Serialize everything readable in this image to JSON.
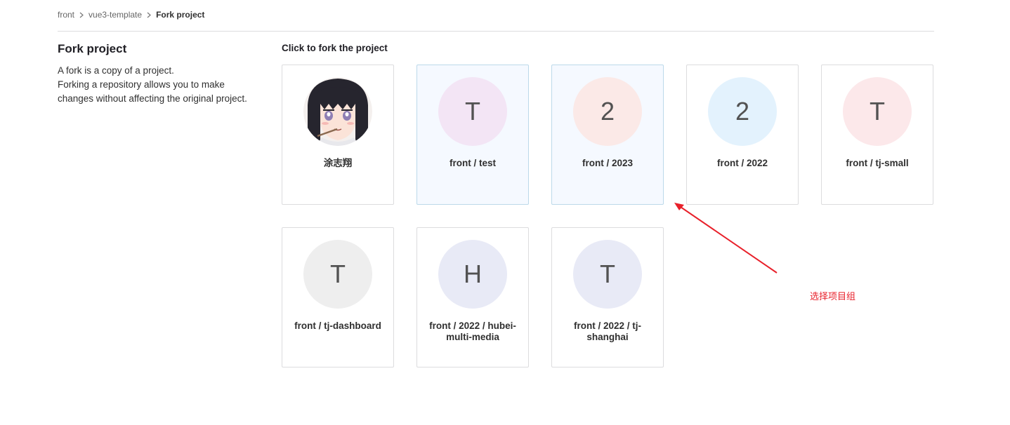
{
  "breadcrumb": {
    "items": [
      "front",
      "vue3-template",
      "Fork project"
    ]
  },
  "page": {
    "title": "Fork project",
    "description_lines": [
      "A fork is a copy of a project.",
      "Forking a repository allows you to make changes without affecting the original project."
    ],
    "section_title": "Click to fork the project"
  },
  "namespaces": [
    {
      "name": "涂志翔",
      "avatar_type": "image",
      "avatar_name": "anime-girl-avatar",
      "selected": false
    },
    {
      "name": "front / test",
      "initial": "T",
      "avatar_color": "#f3e5f5",
      "selected": true
    },
    {
      "name": "front / 2023",
      "initial": "2",
      "avatar_color": "#fbe9e7",
      "selected": true
    },
    {
      "name": "front / 2022",
      "initial": "2",
      "avatar_color": "#e3f2fd",
      "selected": false
    },
    {
      "name": "front / tj-small",
      "initial": "T",
      "avatar_color": "#fce8ea",
      "selected": false
    },
    {
      "name": "front / tj-dashboard",
      "initial": "T",
      "avatar_color": "#eeeeee",
      "selected": false
    },
    {
      "name": "front / 2022 / hubei-multi-media",
      "initial": "H",
      "avatar_color": "#e8eaf6",
      "selected": false
    },
    {
      "name": "front / 2022 / tj-shanghai",
      "initial": "T",
      "avatar_color": "#e8eaf6",
      "selected": false
    }
  ],
  "annotation": {
    "text": "选择项目组",
    "color": "#e8202a"
  }
}
